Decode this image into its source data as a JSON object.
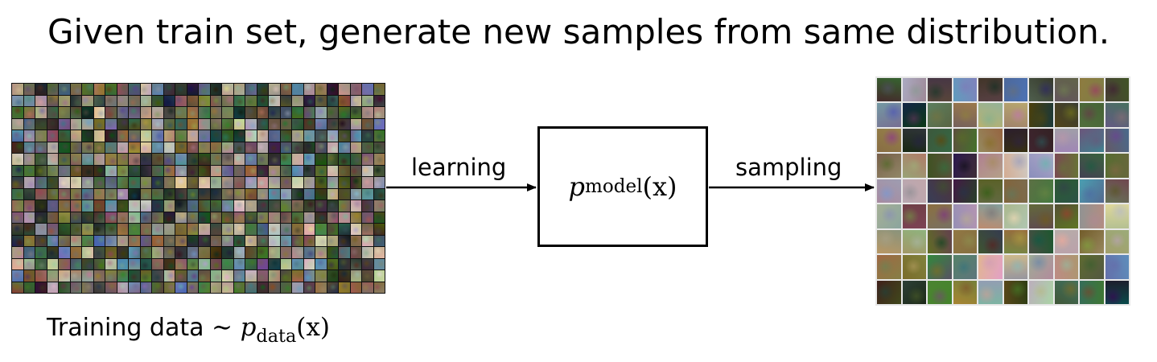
{
  "title": "Given train set, generate new samples from same distribution.",
  "training": {
    "caption_text": "Training data",
    "tilde": "∼",
    "p_symbol": "p",
    "subscript": "data",
    "arg_open": "(",
    "arg": "x",
    "arg_close": ")"
  },
  "arrows": {
    "learning_label": "learning",
    "sampling_label": "sampling"
  },
  "model": {
    "p_symbol": "p",
    "subscript": "model",
    "arg_open": "(",
    "arg": "x",
    "arg_close": ")"
  }
}
